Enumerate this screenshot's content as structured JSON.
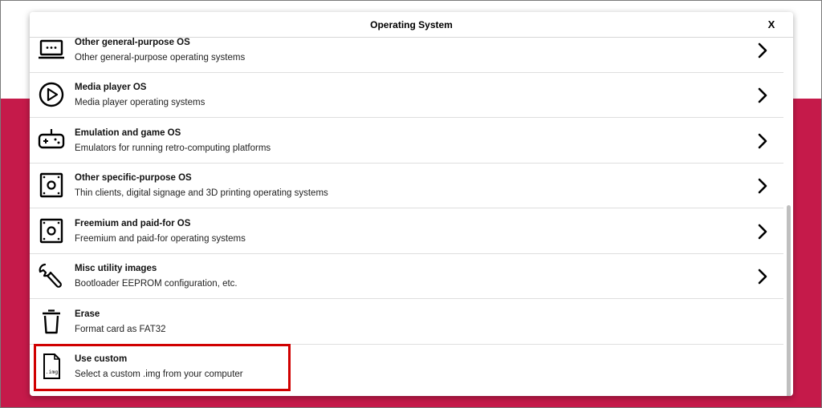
{
  "dialog": {
    "title": "Operating System",
    "close_label": "X"
  },
  "items": [
    {
      "title": "Other general-purpose OS",
      "description": "Other general-purpose operating systems",
      "icon": "laptop-icon",
      "has_submenu": true
    },
    {
      "title": "Media player OS",
      "description": "Media player operating systems",
      "icon": "play-icon",
      "has_submenu": true
    },
    {
      "title": "Emulation and game OS",
      "description": "Emulators for running retro-computing platforms",
      "icon": "gamepad-icon",
      "has_submenu": true
    },
    {
      "title": "Other specific-purpose OS",
      "description": "Thin clients, digital signage and 3D printing operating systems",
      "icon": "board-icon",
      "has_submenu": true
    },
    {
      "title": "Freemium and paid-for OS",
      "description": "Freemium and paid-for operating systems",
      "icon": "board-icon",
      "has_submenu": true
    },
    {
      "title": "Misc utility images",
      "description": "Bootloader EEPROM configuration, etc.",
      "icon": "wrench-icon",
      "has_submenu": true
    },
    {
      "title": "Erase",
      "description": "Format card as FAT32",
      "icon": "trash-icon",
      "has_submenu": false
    },
    {
      "title": "Use custom",
      "description": "Select a custom .img from your computer",
      "icon": "file-img-icon",
      "has_submenu": false,
      "icon_text": ".img"
    }
  ],
  "colors": {
    "background_accent": "#c51a4a",
    "highlight": "#d00000"
  }
}
